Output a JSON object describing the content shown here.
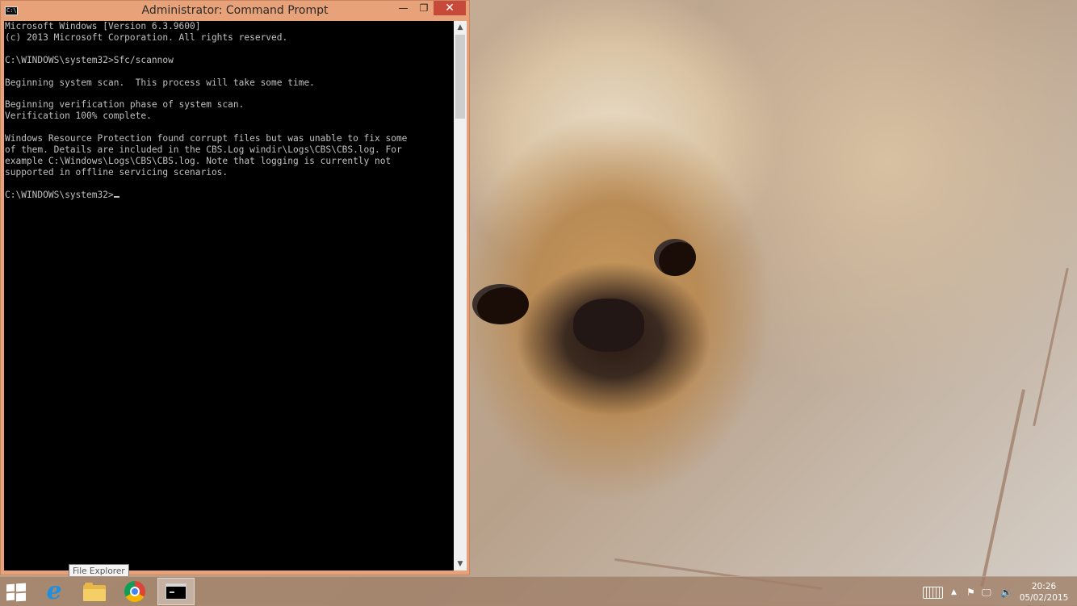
{
  "window": {
    "title": "Administrator: Command Prompt",
    "controls": {
      "minimize": "—",
      "maximize": "❐",
      "close": "✕"
    }
  },
  "console": {
    "lines": [
      "Microsoft Windows [Version 6.3.9600]",
      "(c) 2013 Microsoft Corporation. All rights reserved.",
      "",
      "C:\\WINDOWS\\system32>Sfc/scannow",
      "",
      "Beginning system scan.  This process will take some time.",
      "",
      "Beginning verification phase of system scan.",
      "Verification 100% complete.",
      "",
      "Windows Resource Protection found corrupt files but was unable to fix some",
      "of them. Details are included in the CBS.Log windir\\Logs\\CBS\\CBS.log. For",
      "example C:\\Windows\\Logs\\CBS\\CBS.log. Note that logging is currently not",
      "supported in offline servicing scenarios.",
      ""
    ],
    "prompt": "C:\\WINDOWS\\system32>"
  },
  "tooltip": {
    "text": "File Explorer"
  },
  "taskbar": {
    "apps": [
      {
        "name": "Internet Explorer",
        "icon": "ie-icon"
      },
      {
        "name": "File Explorer",
        "icon": "folder-icon"
      },
      {
        "name": "Google Chrome",
        "icon": "chrome-icon"
      },
      {
        "name": "Command Prompt",
        "icon": "cmd-icon",
        "active": true
      }
    ],
    "tray": {
      "icons": [
        "keyboard-icon",
        "chevron-up-icon",
        "flag-icon",
        "network-icon",
        "speaker-icon"
      ],
      "time": "20:26",
      "date": "05/02/2015"
    }
  },
  "colors": {
    "window_frame": "#e8a27a",
    "close_button": "#c7493a",
    "console_bg": "#000000",
    "console_text": "#c0c0c0"
  }
}
